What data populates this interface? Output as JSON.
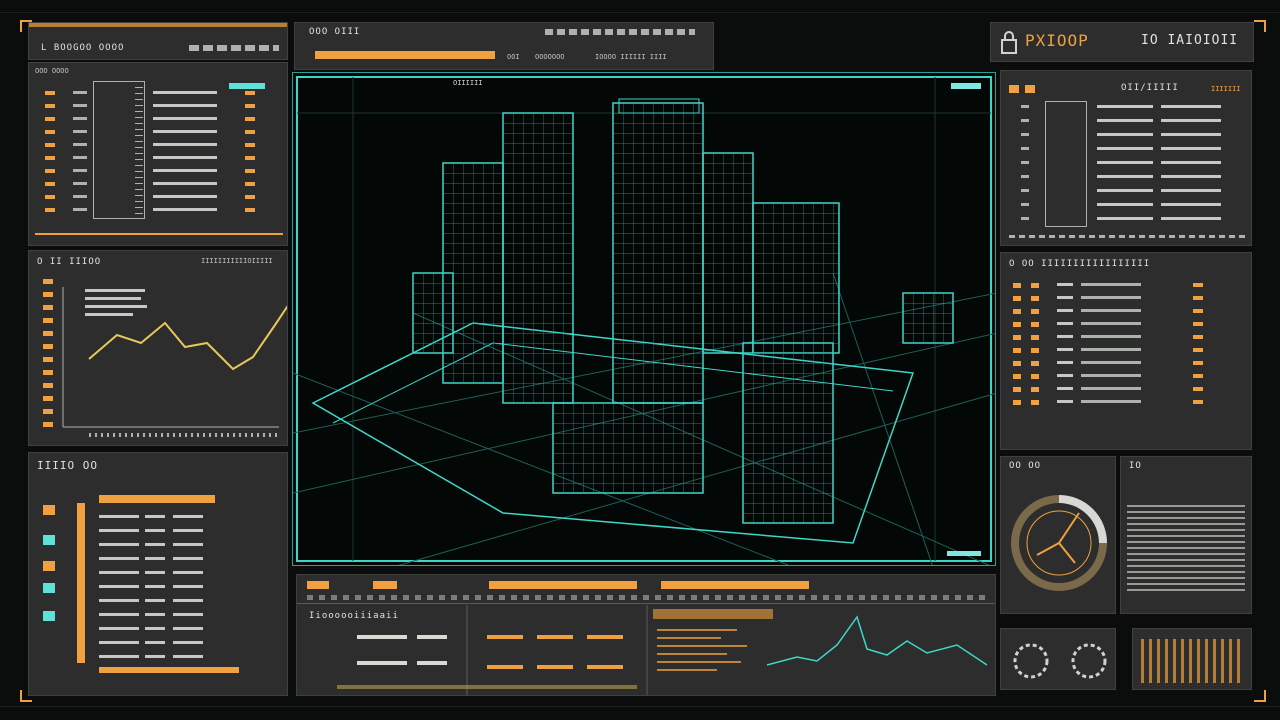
{
  "header": {
    "left_title": "L BOOGOO OOOO",
    "center_title": "OOO OIII",
    "center_sub_a": "OOI",
    "center_sub_b": "OOOOOOO",
    "center_sub_c": "IOOOO IIIIII IIII",
    "right_logo": "PXIOOP",
    "right_code": "IO IAIOIOII"
  },
  "panels": {
    "top_left_title": "OOO OOOO",
    "chart_title": "O II IIIOO",
    "chart_right_label": "IIIIIIIIIIIOIIIII",
    "list_title": "IIIIO OO",
    "viewport_label": "OIIIIII",
    "right_top_title": "OII/IIIII",
    "right_top_right": "IIIIIII",
    "right_mid_title": "O OO IIIIIIIIIIIIIIIII",
    "gauge_title": "OO OO",
    "text_title": "IO",
    "bottom_center_title": "Iioooooiiiaaii"
  },
  "colors": {
    "accent_orange": "#f0a03e",
    "accent_cyan": "#5fe0d8",
    "wire_cyan": "#3fd6c8",
    "panel_bg": "#2c2d2c"
  },
  "icons": {
    "logo": "lock-icon"
  }
}
